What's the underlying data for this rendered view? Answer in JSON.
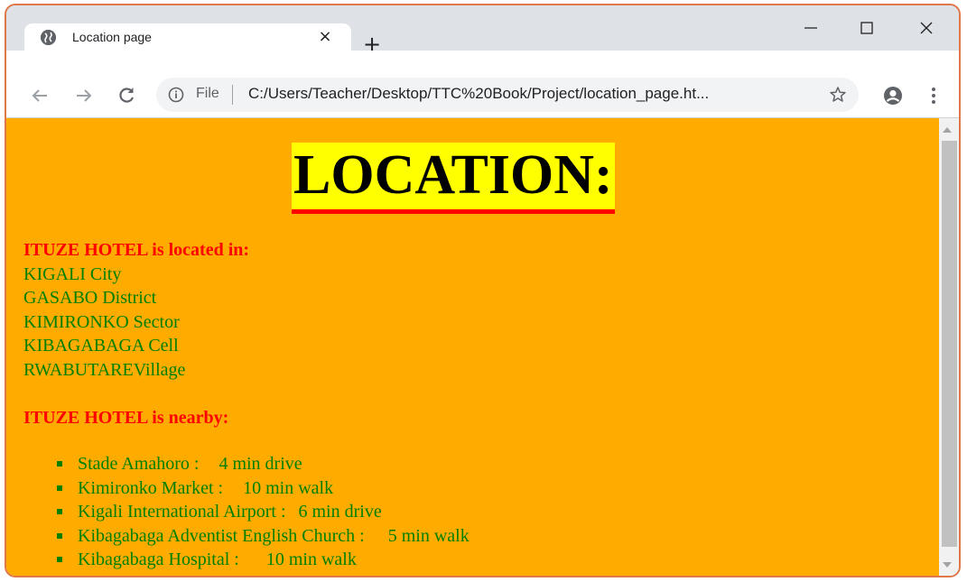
{
  "browser": {
    "tab_title": "Location page",
    "tab_close": "×",
    "new_tab": "+",
    "address_scheme": "File",
    "address_url": "C:/Users/Teacher/Desktop/TTC%20Book/Project/location_page.ht..."
  },
  "page": {
    "heading": "LOCATION:",
    "located_intro": "ITUZE HOTEL is located in:",
    "location_lines": [
      "KIGALI City",
      "GASABO District",
      "KIMIRONKO Sector",
      "KIBAGABAGA Cell",
      "RWABUTAREVillage"
    ],
    "nearby_intro": "ITUZE HOTEL is nearby:",
    "nearby": [
      {
        "place": "Stade Amahoro :",
        "distance": "4 min drive"
      },
      {
        "place": "Kimironko Market :",
        "distance": "10 min walk"
      },
      {
        "place": "Kigali International Airport :",
        "distance": "6 min drive"
      },
      {
        "place": "Kibagabaga Adventist English Church :",
        "distance": "5 min walk"
      },
      {
        "place": "Kibagabaga Hospital :",
        "distance": "10 min walk"
      }
    ]
  },
  "colors": {
    "page_background": "#ffab00",
    "heading_highlight": "#ffff00",
    "heading_underline": "#ff0000",
    "intro_text": "#ff0000",
    "body_text": "#008000"
  }
}
